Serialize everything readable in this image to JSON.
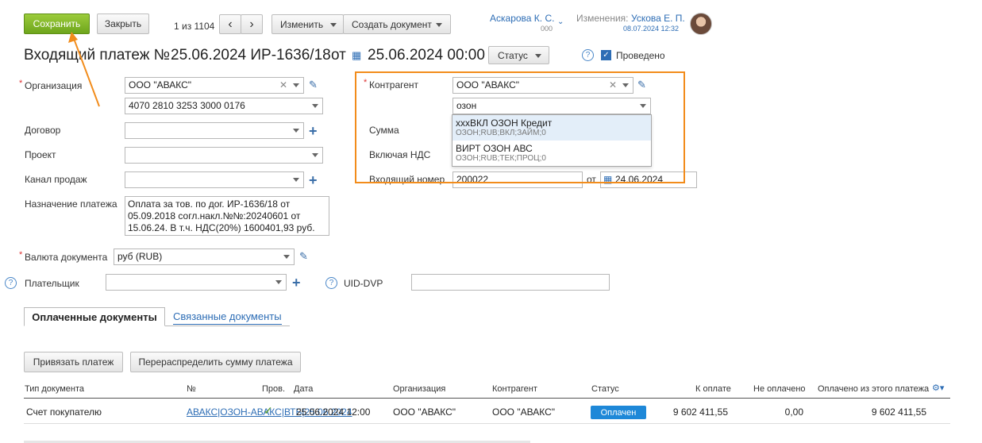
{
  "toolbar": {
    "save_label": "Сохранить",
    "close_label": "Закрыть",
    "pager": "1 из 1104",
    "prev_icon": "chevron-left-icon",
    "next_icon": "chevron-right-icon",
    "edit_label": "Изменить",
    "create_doc_label": "Создать документ"
  },
  "user": {
    "name": "Аскарова К. С.",
    "code": "000",
    "changes_label": "Изменения:",
    "changed_by": "Ускова Е. П.",
    "changed_at": "08.07.2024 12:32"
  },
  "header": {
    "title": "Входящий платеж №",
    "doc_number": "25.06.2024 ИР-1636/18",
    "from_label": "от",
    "doc_datetime": "25.06.2024 00:00",
    "status_label": "Статус",
    "posted_label": "Проведено",
    "posted": true
  },
  "form": {
    "org_label": "Организация",
    "org_value": "ООО \"АВАКС\"",
    "account_value": "4070 2810 3253 3000 0176",
    "contract_label": "Договор",
    "project_label": "Проект",
    "channel_label": "Канал продаж",
    "purpose_label": "Назначение платежа",
    "purpose_value": "Оплата за тов. по дог. ИР-1636/18 от 05.09.2018 согл.накл.№№:20240601 от 15.06.24. В т.ч. НДС(20%) 1600401,93 руб.",
    "currency_label": "Валюта документа",
    "currency_value": "руб (RUB)",
    "payer_label": "Плательщик",
    "uid_label": "UID-DVP",
    "counterparty_label": "Контрагент",
    "counterparty_value": "ООО \"АВАКС\"",
    "search_value": "озон",
    "sum_label": "Сумма",
    "vat_label": "Включая НДС",
    "incoming_no_label": "Входящий номер",
    "incoming_no_value": "200022",
    "incoming_from_label": "от",
    "incoming_date": "24.06.2024"
  },
  "dropdown": {
    "items": [
      {
        "title": "xxxВКЛ ОЗОН Кредит",
        "sub": "ОЗОН;RUB;ВКЛ;ЗАЙМ;0"
      },
      {
        "title": "ВИРТ ОЗОН АВС",
        "sub": "ОЗОН;RUB;ТЕК;ПРОЦ;0"
      }
    ]
  },
  "tabs": {
    "paid_docs": "Оплаченные документы",
    "linked_docs": "Связанные документы"
  },
  "actions": {
    "bind_payment": "Привязать платеж",
    "redistribute": "Перераспределить сумму платежа"
  },
  "table": {
    "headers": {
      "doc_type": "Тип документа",
      "number": "№",
      "checked": "Пров.",
      "date": "Дата",
      "org": "Организация",
      "counterparty": "Контрагент",
      "status": "Статус",
      "to_pay": "К оплате",
      "unpaid": "Не оплачено",
      "paid_from_this": "Оплачено из этого платежа"
    },
    "rows": [
      {
        "doc_type": "Счет покупателю",
        "number": "АВАКС|ОЗОН-АВАКС|ВТБ|25.06.2024",
        "date": "25.06.2024 12:00",
        "org": "ООО \"АВАКС\"",
        "counterparty": "ООО \"АВАКС\"",
        "status": "Оплачен",
        "to_pay": "9 602 411,55",
        "unpaid": "0,00",
        "paid_from_this": "9 602 411,55"
      }
    ]
  },
  "colors": {
    "save_green": "#7cb42a",
    "highlight_orange": "#f28c1b",
    "link_blue": "#2d6db5",
    "status_badge": "#1e88d8"
  }
}
